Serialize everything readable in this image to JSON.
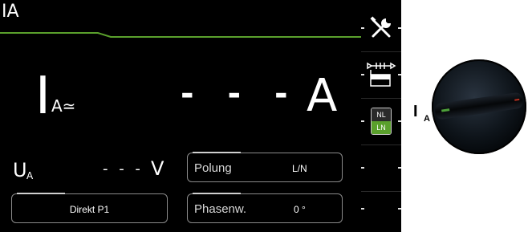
{
  "screen": {
    "mode_title": "IA",
    "main": {
      "symbol": "I",
      "subscript": "A≃",
      "value": "- - -",
      "unit": "A"
    },
    "voltage": {
      "symbol": "U",
      "subscript": "A",
      "value": "- - -",
      "unit": "V"
    },
    "fields": {
      "polarity": {
        "label": "Polung",
        "value": "L/N"
      },
      "probe": {
        "value": "Direkt P1"
      },
      "phase": {
        "label": "Phasenw.",
        "value": "0 °"
      }
    }
  },
  "sidebar": {
    "tools_icon": "wrench-screwdriver-icon",
    "sequence_icon": "test-sequence-icon",
    "nl_ln": {
      "top": "NL",
      "bottom": "LN"
    }
  },
  "knob": {
    "label": "I",
    "label_sub": "A"
  },
  "colors": {
    "accent_green": "#5aa02c",
    "background": "#000000",
    "foreground": "#ffffff"
  }
}
